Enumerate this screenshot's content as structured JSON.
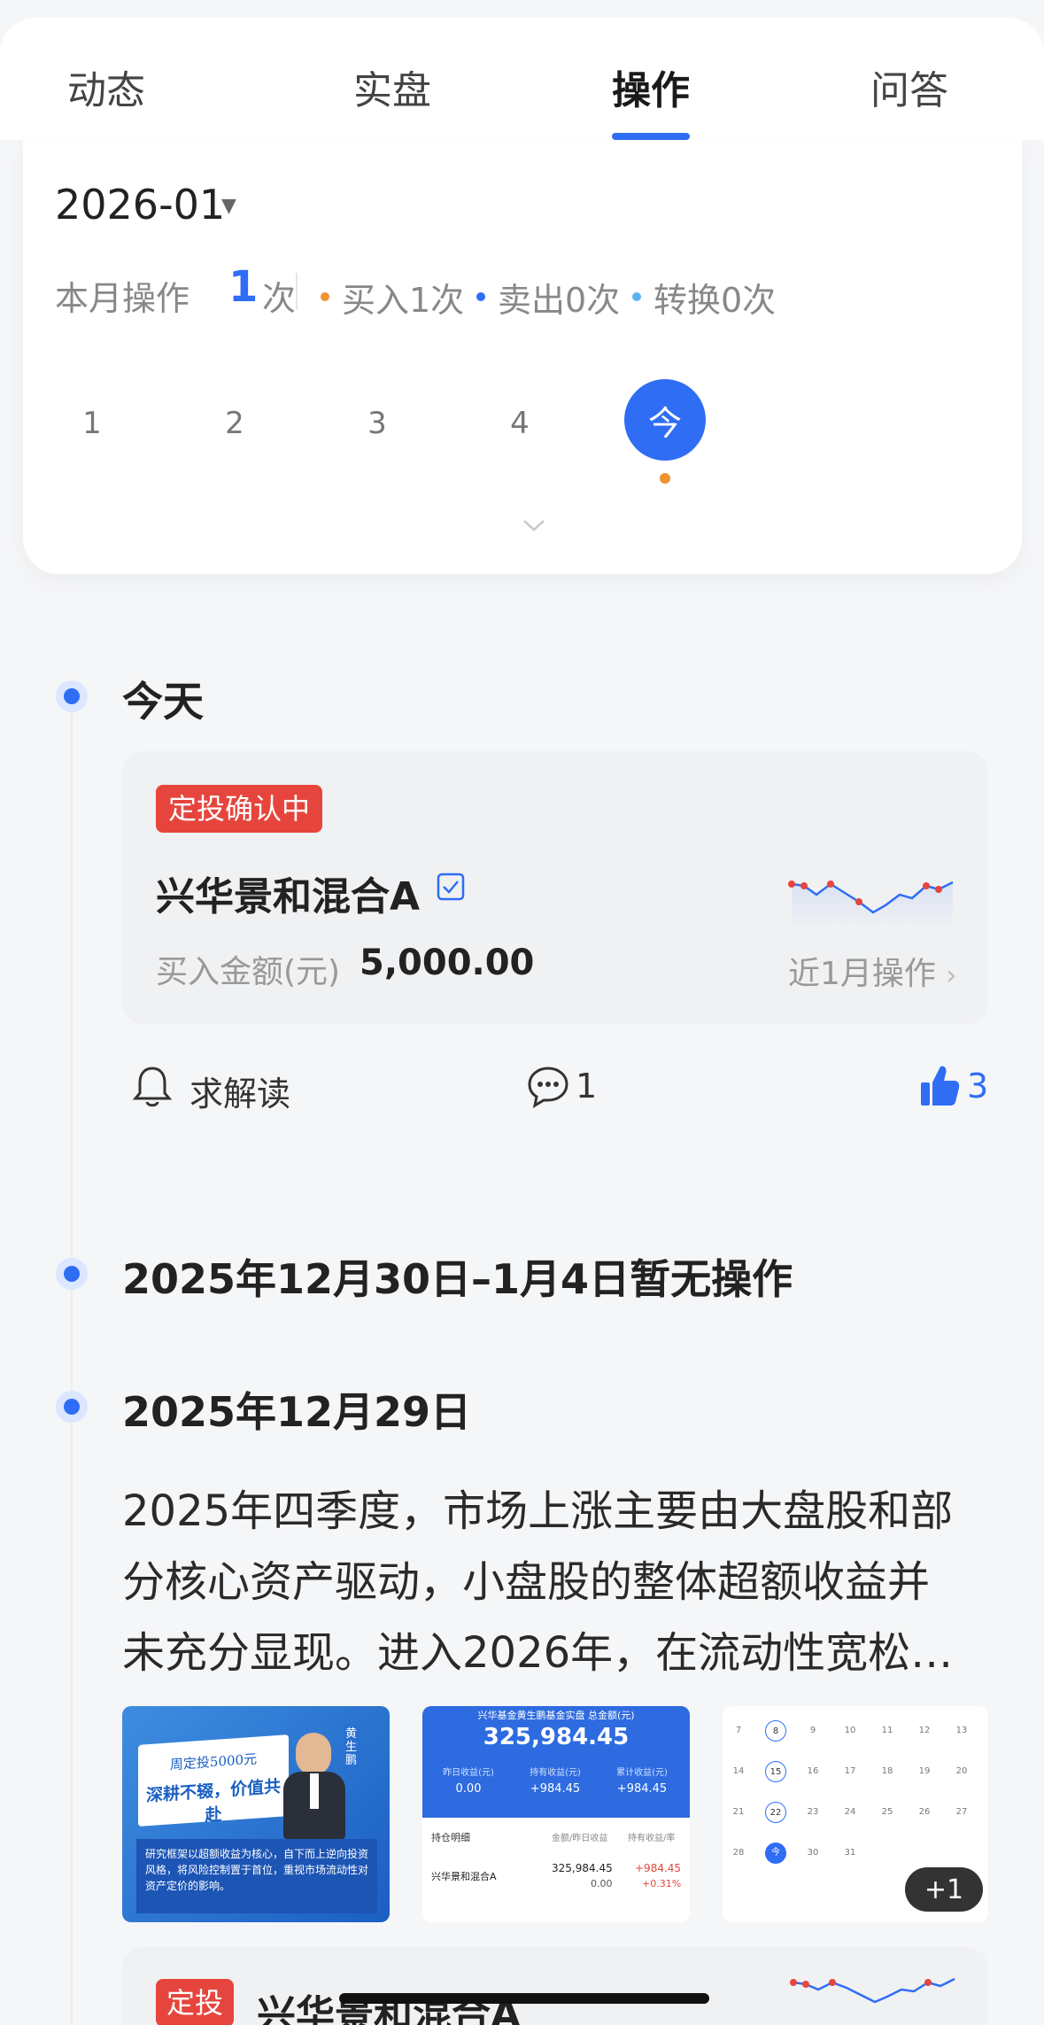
{
  "tabs": [
    {
      "label": "动态"
    },
    {
      "label": "实盘"
    },
    {
      "label": "操作"
    },
    {
      "label": "问答"
    }
  ],
  "month": {
    "value": "2026-01",
    "summary_prefix": "本月操作",
    "summary_count": "1",
    "summary_suffix": "次",
    "stats": [
      {
        "label": "买入1次",
        "color": "#f0922e"
      },
      {
        "label": "卖出0次",
        "color": "#2f6df5"
      },
      {
        "label": "转换0次",
        "color": "#5ab3f0"
      }
    ],
    "days": [
      "1",
      "2",
      "3",
      "4"
    ],
    "today_label": "今"
  },
  "timeline": {
    "today_title": "今天",
    "card": {
      "badge": "定投确认中",
      "fund_name": "兴华景和混合A",
      "amount_label": "买入金额(元)",
      "amount_value": "5,000.00",
      "recent_link": "近1月操作"
    },
    "actions": {
      "interpret": "求解读",
      "comments": "1",
      "likes": "3"
    },
    "no_op_title": "2025年12月30日–1月4日暂无操作",
    "date_title": "2025年12月29日",
    "paragraph_lines": [
      "2025年四季度，市场上涨主要由大盘股和部",
      "分核心资产驱动，小盘股的整体超额收益并",
      "未充分显现。进入2026年，在流动性宽松…"
    ],
    "image1": {
      "name": "黄生鹏",
      "headline1": "周定投5000元",
      "headline2": "深耕不辍，价值共赴",
      "body": "研究框架以超额收益为核心，自下而上逆向投资风格，将风险控制置于首位，重视市场流动性对资产定价的影响。"
    },
    "image2": {
      "header": "兴华基金黄生鹏基金实盘 总金额(元)",
      "total": "325,984.45",
      "col1": "昨日收益(元)",
      "col2": "持有收益(元)",
      "col3": "累计收益(元)",
      "v1": "0.00",
      "v2": "+984.45",
      "v3": "+984.45",
      "th1": "持仓明细",
      "th2": "金额/昨日收益",
      "th3": "持有收益/率",
      "row_fund": "兴华景和混合A",
      "row_amount": "325,984.45",
      "row_yday": "0.00",
      "row_gain": "+984.45",
      "row_rate": "+0.31%"
    },
    "image3": {
      "rows": [
        [
          "7",
          "8",
          "9",
          "10",
          "11",
          "12",
          "13"
        ],
        [
          "14",
          "15",
          "16",
          "17",
          "18",
          "19",
          "20"
        ],
        [
          "21",
          "22",
          "23",
          "24",
          "25",
          "26",
          "27"
        ],
        [
          "28",
          "今",
          "30",
          "31",
          "",
          "",
          ""
        ]
      ]
    },
    "more_count": "+1",
    "next_card": {
      "badge": "定投",
      "fund_name": "兴华景和混合A"
    }
  }
}
